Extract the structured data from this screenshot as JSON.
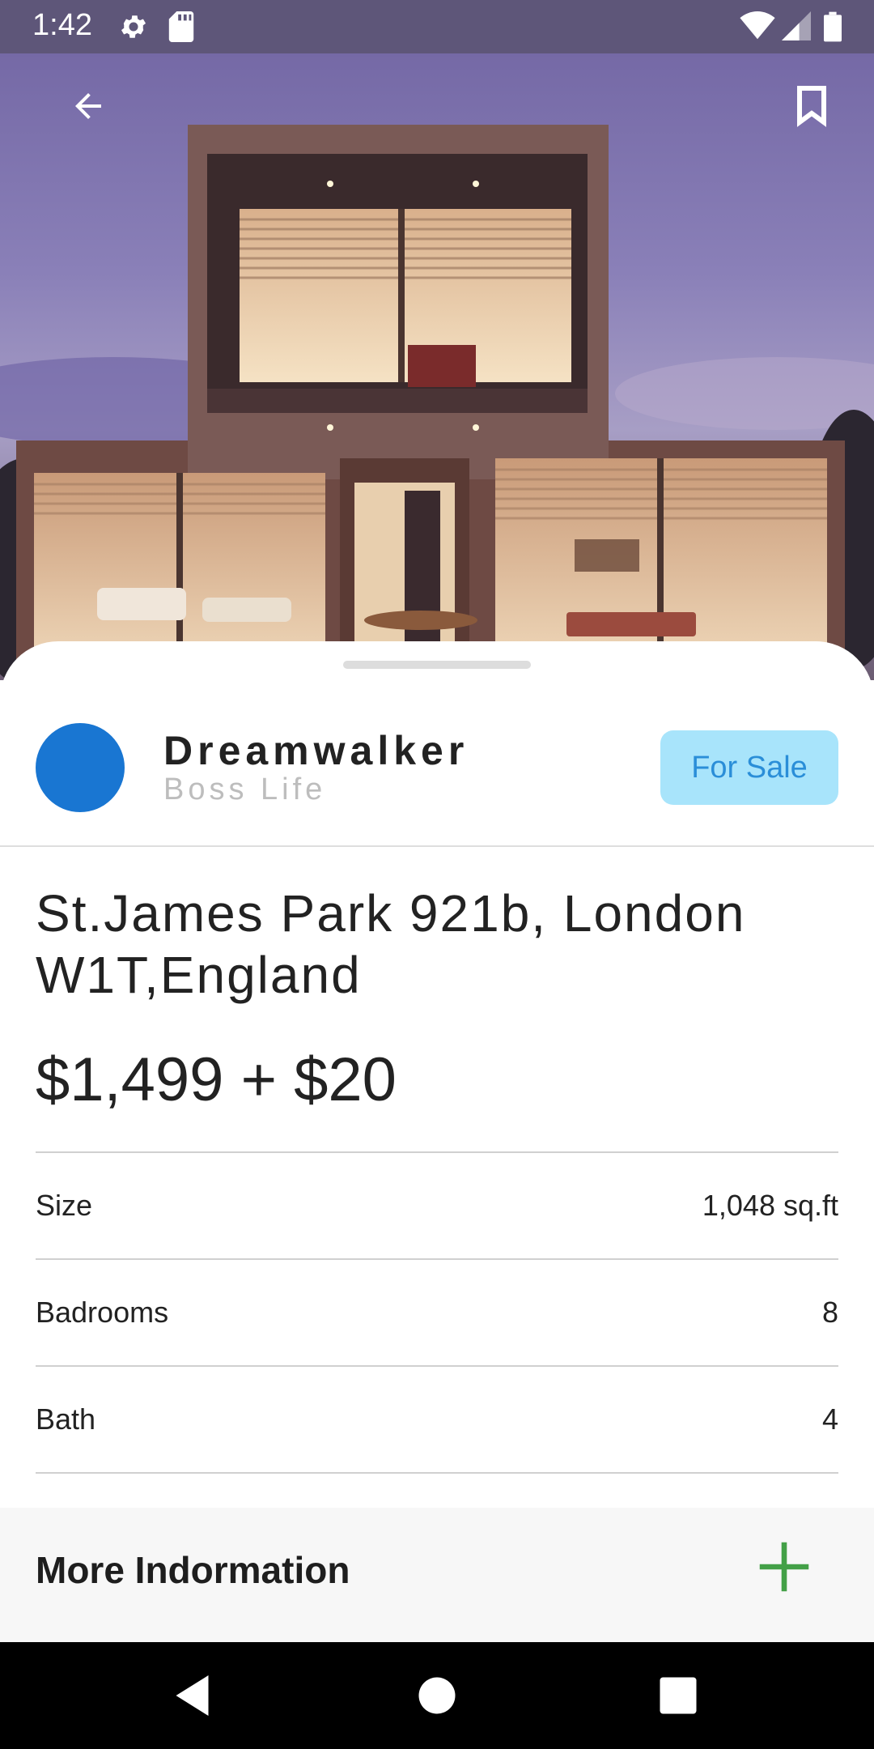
{
  "status_bar": {
    "time": "1:42"
  },
  "listing": {
    "agent_name": "Dreamwalker",
    "agent_subtitle": "Boss Life",
    "status_label": "For Sale",
    "address": "St.James Park 921b, London W1T,England",
    "price": "$1,499 + $20"
  },
  "specs": [
    {
      "label": "Size",
      "value": "1,048 sq.ft"
    },
    {
      "label": "Badrooms",
      "value": "8"
    },
    {
      "label": "Bath",
      "value": "4"
    }
  ],
  "more_info": {
    "label": "More Indormation"
  },
  "colors": {
    "avatar": "#1976d2",
    "badge_bg": "#a8e4fb",
    "badge_text": "#2a8ed8",
    "plus_icon": "#43a047",
    "status_bar": "#5e5679"
  },
  "icons": [
    "settings-icon",
    "sd-card-icon",
    "wifi-icon",
    "signal-icon",
    "battery-icon",
    "back-arrow-icon",
    "bookmark-icon",
    "plus-icon",
    "nav-back-icon",
    "nav-home-icon",
    "nav-recents-icon"
  ]
}
